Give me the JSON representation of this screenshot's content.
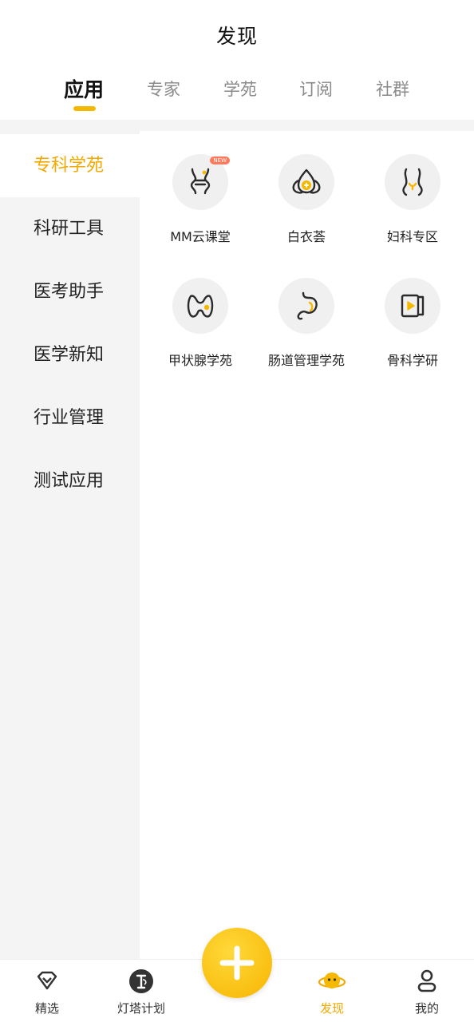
{
  "header": {
    "title": "发现"
  },
  "tabs": [
    {
      "label": "应用",
      "active": true
    },
    {
      "label": "专家",
      "active": false
    },
    {
      "label": "学苑",
      "active": false
    },
    {
      "label": "订阅",
      "active": false
    },
    {
      "label": "社群",
      "active": false
    }
  ],
  "sidebar": {
    "items": [
      {
        "label": "专科学苑",
        "active": true
      },
      {
        "label": "科研工具",
        "active": false
      },
      {
        "label": "医考助手",
        "active": false
      },
      {
        "label": "医学新知",
        "active": false
      },
      {
        "label": "行业管理",
        "active": false
      },
      {
        "label": "测试应用",
        "active": false
      }
    ]
  },
  "apps": [
    {
      "label": "MM云课堂",
      "icon": "knee-joint-icon",
      "badge": "NEW"
    },
    {
      "label": "白衣荟",
      "icon": "lotus-cross-icon"
    },
    {
      "label": "妇科专区",
      "icon": "pelvis-icon"
    },
    {
      "label": "甲状腺学苑",
      "icon": "thyroid-icon"
    },
    {
      "label": "肠道管理学苑",
      "icon": "intestine-icon"
    },
    {
      "label": "骨科学研",
      "icon": "video-book-icon"
    }
  ],
  "bottom_nav": [
    {
      "label": "精选",
      "icon": "diamond-icon"
    },
    {
      "label": "灯塔计划",
      "icon": "lighthouse-logo-icon"
    },
    {
      "label": "发现",
      "icon": "planet-face-icon",
      "active": true
    },
    {
      "label": "我的",
      "icon": "person-icon"
    }
  ],
  "colors": {
    "accent": "#f2a900",
    "sidebar_bg": "#f4f4f5",
    "icon_bg": "#f0f0f0"
  }
}
